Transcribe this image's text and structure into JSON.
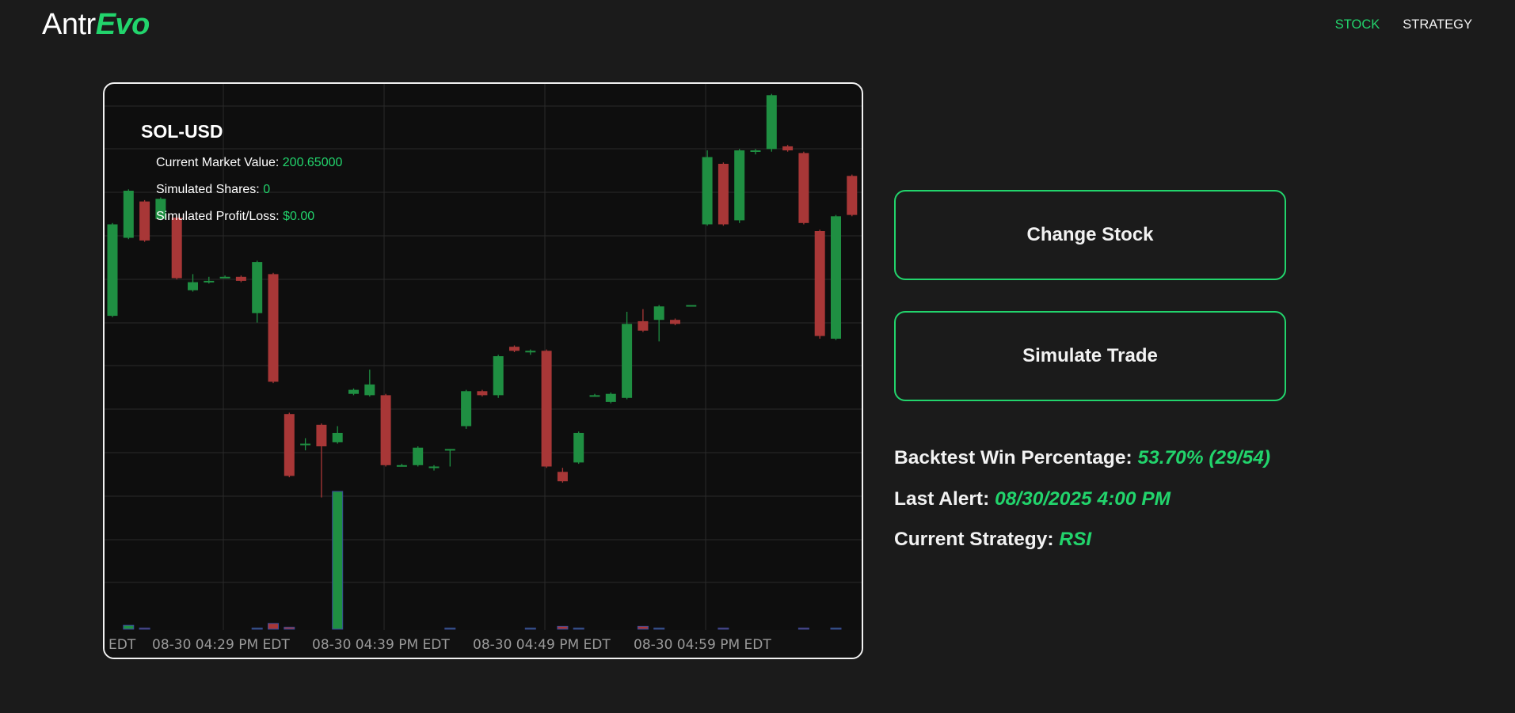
{
  "header": {
    "logo_prefix": "Antr",
    "logo_suffix": "Evo",
    "nav": [
      {
        "label": "STOCK",
        "active": true
      },
      {
        "label": "STRATEGY",
        "active": false
      }
    ]
  },
  "chart": {
    "symbol": "SOL-USD",
    "market_value_label": "Current Market Value: ",
    "market_value": "200.65000",
    "shares_label": "Simulated Shares: ",
    "shares": "0",
    "pl_label": "Simulated Profit/Loss: ",
    "pl": "$0.00",
    "x_labels": [
      "EDT",
      "08-30 04:29 PM EDT",
      "08-30 04:39 PM EDT",
      "08-30 04:49 PM EDT",
      "08-30 04:59 PM EDT"
    ]
  },
  "buttons": {
    "change_stock": "Change Stock",
    "simulate_trade": "Simulate Trade"
  },
  "stats": {
    "backtest_label": "Backtest Win Percentage: ",
    "backtest_value": "53.70% (29/54)",
    "alert_label": "Last Alert: ",
    "alert_value": "08/30/2025 4:00 PM",
    "strategy_label": "Current Strategy: ",
    "strategy_value": "RSI"
  },
  "colors": {
    "accent": "#22d46c",
    "up": "#1f8f42",
    "down": "#a83737",
    "background": "#1b1b1b"
  },
  "chart_data": {
    "type": "candlestick",
    "symbol": "SOL-USD",
    "x_tick_labels": [
      "08-30 04:29 PM EDT",
      "08-30 04:39 PM EDT",
      "08-30 04:49 PM EDT",
      "08-30 04:59 PM EDT"
    ],
    "price_scale": "unlabeled (relative)",
    "candles": [
      {
        "o": 37,
        "c": 105,
        "h": 106,
        "l": 36
      },
      {
        "o": 95,
        "c": 130,
        "h": 131,
        "l": 94
      },
      {
        "o": 122,
        "c": 93,
        "h": 123,
        "l": 92
      },
      {
        "o": 109,
        "c": 124,
        "h": 125,
        "l": 108
      },
      {
        "o": 110,
        "c": 65,
        "h": 111,
        "l": 64
      },
      {
        "o": 56,
        "c": 62,
        "h": 68,
        "l": 55
      },
      {
        "o": 63,
        "c": 63,
        "h": 66,
        "l": 61
      },
      {
        "o": 66,
        "c": 66,
        "h": 67,
        "l": 65
      },
      {
        "o": 66,
        "c": 63,
        "h": 67,
        "l": 62
      },
      {
        "o": 39,
        "c": 77,
        "h": 78,
        "l": 32
      },
      {
        "o": 68,
        "c": -12,
        "h": 69,
        "l": -13
      },
      {
        "o": -36,
        "c": -82,
        "h": -35,
        "l": -83
      },
      {
        "o": -58,
        "c": -58,
        "h": -54,
        "l": -63
      },
      {
        "o": -44,
        "c": -60,
        "h": -43,
        "l": -98
      },
      {
        "o": -57,
        "c": -50,
        "h": -45,
        "l": -58
      },
      {
        "o": -21,
        "c": -18,
        "h": -17,
        "l": -22
      },
      {
        "o": -22,
        "c": -14,
        "h": -3,
        "l": -23
      },
      {
        "o": -22,
        "c": -74,
        "h": -21,
        "l": -75
      },
      {
        "o": -74,
        "c": -74,
        "h": -73,
        "l": -75
      },
      {
        "o": -74,
        "c": -61,
        "h": -60,
        "l": -75
      },
      {
        "o": -75,
        "c": -75,
        "h": -74,
        "l": -78
      },
      {
        "o": -62,
        "c": -62,
        "h": -62,
        "l": -75
      },
      {
        "o": -45,
        "c": -19,
        "h": -18,
        "l": -47
      },
      {
        "o": -19,
        "c": -22,
        "h": -18,
        "l": -23
      },
      {
        "o": -22,
        "c": 7,
        "h": 8,
        "l": -24
      },
      {
        "o": 14,
        "c": 11,
        "h": 15,
        "l": 10
      },
      {
        "o": 11,
        "c": 11,
        "h": 12,
        "l": 8
      },
      {
        "o": 11,
        "c": -75,
        "h": 12,
        "l": -76
      },
      {
        "o": -79,
        "c": -86,
        "h": -76,
        "l": -87
      },
      {
        "o": -72,
        "c": -50,
        "h": -49,
        "l": -73
      },
      {
        "o": -22,
        "c": -22,
        "h": -21,
        "l": -23
      },
      {
        "o": -27,
        "c": -21,
        "h": -20,
        "l": -28
      },
      {
        "o": -24,
        "c": 31,
        "h": 40,
        "l": -25
      },
      {
        "o": 33,
        "c": 26,
        "h": 42,
        "l": 25
      },
      {
        "o": 34,
        "c": 44,
        "h": 45,
        "l": 18
      },
      {
        "o": 34,
        "c": 31,
        "h": 35,
        "l": 30
      },
      {
        "o": 45,
        "c": 45,
        "h": 45,
        "l": 44
      },
      {
        "o": 105,
        "c": 155,
        "h": 160,
        "l": 104
      },
      {
        "o": 150,
        "c": 105,
        "h": 151,
        "l": 104
      },
      {
        "o": 108,
        "c": 160,
        "h": 161,
        "l": 106
      },
      {
        "o": 160,
        "c": 160,
        "h": 161,
        "l": 157
      },
      {
        "o": 161,
        "c": 201,
        "h": 202,
        "l": 159
      },
      {
        "o": 163,
        "c": 160,
        "h": 164,
        "l": 159
      },
      {
        "o": 158,
        "c": 106,
        "h": 159,
        "l": 105
      },
      {
        "o": 100,
        "c": 22,
        "h": 101,
        "l": 20
      },
      {
        "o": 20,
        "c": 111,
        "h": 112,
        "l": 19
      },
      {
        "o": 141,
        "c": 112,
        "h": 142,
        "l": 111
      }
    ],
    "volumes": [
      0,
      4,
      1,
      0,
      0,
      0,
      0,
      0,
      0,
      1,
      6,
      2,
      0,
      0,
      145,
      0,
      0,
      0,
      0,
      0,
      0,
      1,
      0,
      0,
      0,
      0,
      1,
      0,
      3,
      1,
      0,
      0,
      0,
      3,
      1,
      0,
      0,
      0,
      1,
      0,
      0,
      0,
      0,
      1,
      0,
      1,
      0,
      0,
      9
    ]
  }
}
